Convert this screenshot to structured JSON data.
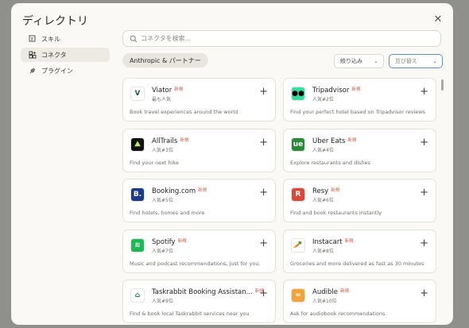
{
  "dialog": {
    "title": "ディレクトリ"
  },
  "nav": {
    "items": [
      {
        "label": "スキル",
        "icon": "skill-icon",
        "active": false
      },
      {
        "label": "コネクタ",
        "icon": "connector-icon",
        "active": true
      },
      {
        "label": "プラグイン",
        "icon": "plugin-icon",
        "active": false
      }
    ]
  },
  "search": {
    "placeholder": "コネクタを検索..."
  },
  "filter_chip": {
    "label": "Anthropic & パートナー"
  },
  "filter_dropdown": {
    "label": "絞り込み"
  },
  "sort_dropdown": {
    "label": "並び替え"
  },
  "colors": {
    "new_badge": "#c8624a",
    "focus": "#5b8fd4"
  },
  "connectors": [
    {
      "name": "Viator",
      "badge": "新規",
      "rank": "最も人気",
      "desc": "Book travel experiences around the world",
      "logo_text": "V",
      "logo_color": "#1a5b4a",
      "logo_bg": "#ffffff",
      "icon": "viator-icon"
    },
    {
      "name": "Tripadvisor",
      "badge": "新規",
      "rank": "人気#2位",
      "desc": "Find your perfect hotel based on Tripadvisor reviews",
      "logo_text": "●●",
      "logo_color": "#000000",
      "logo_bg": "#34e0a1",
      "icon": "tripadvisor-icon"
    },
    {
      "name": "AllTrails",
      "badge": "新規",
      "rank": "人気#3位",
      "desc": "Find your next hike",
      "logo_text": "⛰",
      "logo_color": "#b6f06a",
      "logo_bg": "#111111",
      "icon": "alltrails-icon"
    },
    {
      "name": "Uber Eats",
      "badge": "新規",
      "rank": "人気#4位",
      "desc": "Explore restaurants and dishes",
      "logo_text": "ue",
      "logo_color": "#ffffff",
      "logo_bg": "#2a8c3a",
      "icon": "uber-eats-icon"
    },
    {
      "name": "Booking.com",
      "badge": "新規",
      "rank": "人気#5位",
      "desc": "Find hotels, homes and more",
      "logo_text": "B.",
      "logo_color": "#ffffff",
      "logo_bg": "#1a3a8a",
      "icon": "booking-icon"
    },
    {
      "name": "Resy",
      "badge": "新規",
      "rank": "人気#6位",
      "desc": "Find and book restaurants instantly",
      "logo_text": "R",
      "logo_color": "#ffffff",
      "logo_bg": "#e0453a",
      "icon": "resy-icon"
    },
    {
      "name": "Spotify",
      "badge": "新規",
      "rank": "人気#7位",
      "desc": "Music and podcast recommendations, just for you.",
      "logo_text": "≋",
      "logo_color": "#ffffff",
      "logo_bg": "#1db954",
      "icon": "spotify-icon"
    },
    {
      "name": "Instacart",
      "badge": "新規",
      "rank": "人気#8位",
      "desc": "Groceries and more delivered as fast as 30 minutes",
      "logo_text": "🥕",
      "logo_color": "#ff7a00",
      "logo_bg": "#ffffff",
      "icon": "instacart-icon"
    },
    {
      "name": "Taskrabbit Booking Assistan...",
      "badge": "新規",
      "rank": "人気#9位",
      "desc": "Find & book local Taskrabbit services near you",
      "logo_text": "⌂",
      "logo_color": "#1a8a5a",
      "logo_bg": "#ffffff",
      "icon": "taskrabbit-icon"
    },
    {
      "name": "Audible",
      "badge": "新規",
      "rank": "人気#10位",
      "desc": "Ask for audiobook recommendations",
      "logo_text": "≈",
      "logo_color": "#ffffff",
      "logo_bg": "#f3a33a",
      "icon": "audible-icon"
    }
  ]
}
